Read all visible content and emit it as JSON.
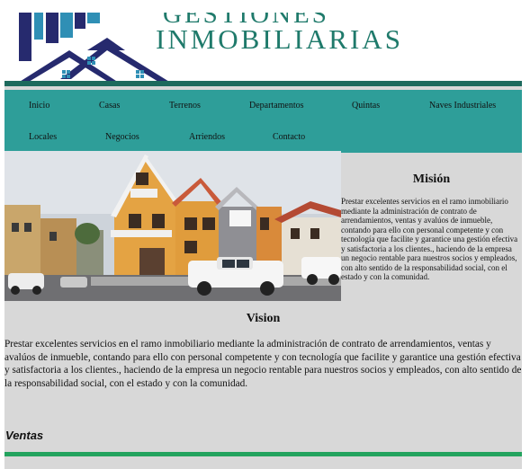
{
  "brand": {
    "top_line": "GESTIONES",
    "name": "INMOBILIARIAS"
  },
  "nav": {
    "items": [
      {
        "label": "Inicio"
      },
      {
        "label": "Casas"
      },
      {
        "label": "Terrenos"
      },
      {
        "label": "Departamentos"
      },
      {
        "label": "Quintas"
      },
      {
        "label": "Naves Industriales"
      },
      {
        "label": "Locales"
      },
      {
        "label": "Negocios"
      },
      {
        "label": "Arriendos"
      },
      {
        "label": "Contacto"
      }
    ]
  },
  "mision": {
    "title": "Misión",
    "text": "Prestar excelentes servicios en el ramo inmobiliario mediante la administración de contrato de arrendamientos, ventas y avalúos de inmueble, contando para ello con personal competente y con tecnología que facilite y garantice una gestión efectiva y satisfactoria a los clientes., haciendo de la empresa un negocio rentable para nuestros socios y empleados, con alto sentido de la responsabilidad social, con el estado y con la comunidad."
  },
  "vision": {
    "title": "Vision",
    "text": "Prestar excelentes servicios en el ramo inmobiliario mediante la administración de contrato de arrendamientos, ventas y avalúos de inmueble, contando para ello con personal competente y con tecnología que facilite y garantice una gestión efectiva y satisfactoria a los clientes., haciendo de la empresa un negocio rentable para nuestros socios y empleados, con alto sentido de la responsabilidad social, con el estado y con la comunidad."
  },
  "ventas": {
    "title": "Ventas"
  },
  "colors": {
    "brand_teal": "#1f7a6b",
    "nav_bg": "#2e9e99",
    "page_bg": "#d8d8d8",
    "bottom_rule": "#23a35e",
    "logo_navy": "#262a6e"
  },
  "icons": [
    "house-logo-icon",
    "building-logo-icon"
  ]
}
